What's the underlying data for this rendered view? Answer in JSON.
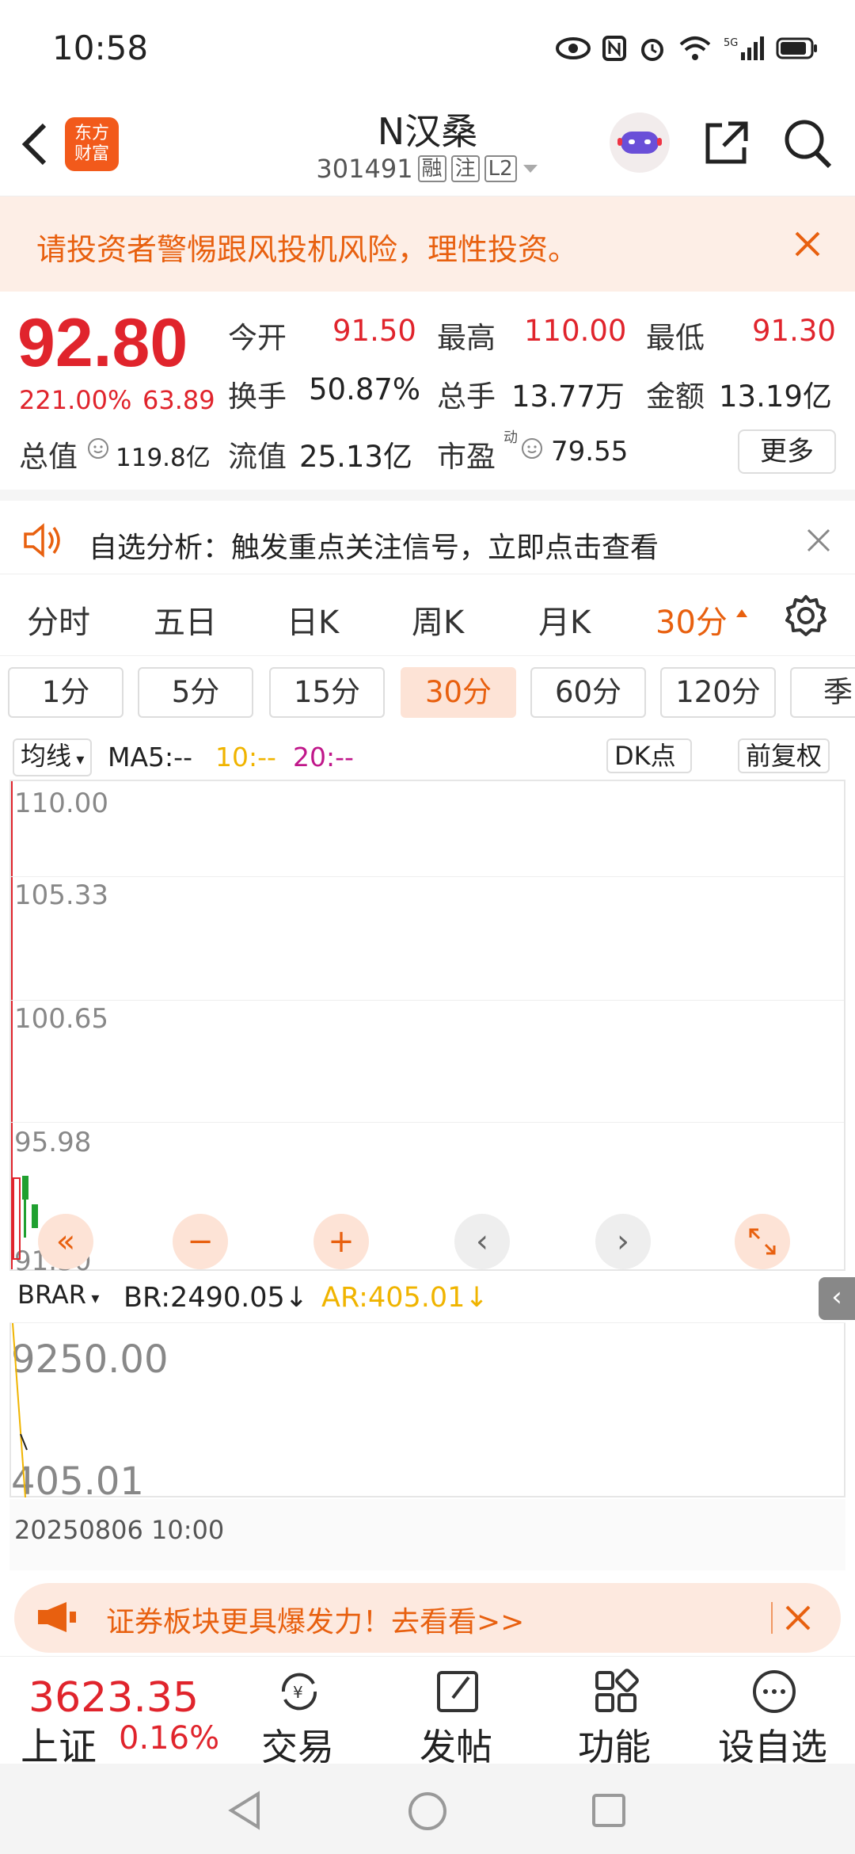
{
  "status_bar": {
    "time": "10:58"
  },
  "header": {
    "title": "N汉桑",
    "code": "301491",
    "tags": [
      "融",
      "注",
      "L2"
    ],
    "logo_text": [
      "东方",
      "财富"
    ]
  },
  "warning": {
    "text": "请投资者警惕跟风投机风险，理性投资。"
  },
  "quote": {
    "price": "92.80",
    "change_pct": "221.00%",
    "change_amt": "63.89",
    "fields": {
      "open_label": "今开",
      "open": "91.50",
      "high_label": "最高",
      "high": "110.00",
      "low_label": "最低",
      "low": "91.30",
      "turnover_label": "换手",
      "turnover": "50.87%",
      "volume_label": "总手",
      "volume": "13.77万",
      "amount_label": "金额",
      "amount": "13.19亿",
      "mktcap_label": "总值",
      "mktcap": "119.8亿",
      "float_label": "流值",
      "float": "25.13亿",
      "pe_label": "市盈",
      "pe_sup": "动",
      "pe": "79.55"
    },
    "more_label": "更多"
  },
  "analysis": {
    "text": "自选分析：触发重点关注信号，立即点击查看"
  },
  "period_tabs": [
    "分时",
    "五日",
    "日K",
    "周K",
    "月K",
    "30分"
  ],
  "period_active": "30分",
  "minute_tabs": [
    "1分",
    "5分",
    "15分",
    "30分",
    "60分",
    "120分",
    "季"
  ],
  "minute_active": "30分",
  "indicator": {
    "ma_label": "均线",
    "ma5": "MA5:--",
    "ma10": "10:--",
    "ma20": "20:--",
    "dk_label": "DK点",
    "fq_label": "前复权"
  },
  "chart_data": {
    "type": "candlestick",
    "y_ticks": [
      "110.00",
      "105.33",
      "100.65",
      "95.98",
      "91.30"
    ],
    "ylim": [
      91.3,
      110.0
    ]
  },
  "brar": {
    "label": "BRAR",
    "br": "BR:2490.05",
    "ar": "AR:405.01",
    "ticks": [
      "9250.00",
      "405.01"
    ],
    "date": "20250806 10:00"
  },
  "promo": {
    "text": "证券板块更具爆发力！去看看>>"
  },
  "bottom_nav": {
    "index_value": "3623.35",
    "index_name": "上证",
    "index_change": "0.16%",
    "items": [
      "交易",
      "发帖",
      "功能",
      "设自选"
    ]
  },
  "colors": {
    "up": "#e0242c",
    "accent": "#e8600f",
    "ma10": "#f0b400",
    "ma20": "#c0178a"
  }
}
